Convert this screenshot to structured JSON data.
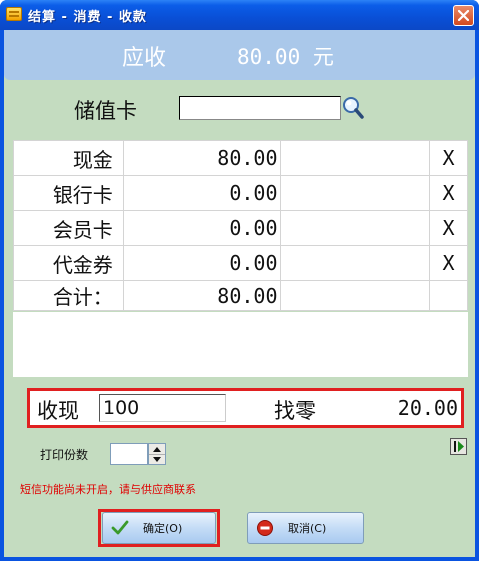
{
  "window": {
    "title": "结算 - 消费 - 收款"
  },
  "header": {
    "label": "应收",
    "amount": "80.00 元"
  },
  "stored_value_card": {
    "label": "储值卡",
    "value": ""
  },
  "payments": [
    {
      "name": "现金",
      "amount": "80.00",
      "remove": "X"
    },
    {
      "name": "银行卡",
      "amount": "0.00",
      "remove": "X"
    },
    {
      "name": "会员卡",
      "amount": "0.00",
      "remove": "X"
    },
    {
      "name": "代金券",
      "amount": "0.00",
      "remove": "X"
    }
  ],
  "total": {
    "label": "合计：",
    "amount": "80.00"
  },
  "receive": {
    "label": "收现",
    "value": "100",
    "change_label": "找零",
    "change_value": "20.00"
  },
  "print": {
    "copies_label": "打印份数",
    "copies_value": ""
  },
  "notice": "短信功能尚未开启，请与供应商联系",
  "buttons": {
    "ok": "确定(O)",
    "cancel": "取消(C)"
  },
  "colors": {
    "highlight": "#e02020",
    "panel": "#c4dcc0",
    "header_band": "#aac8ea",
    "notice": "#e00000"
  }
}
